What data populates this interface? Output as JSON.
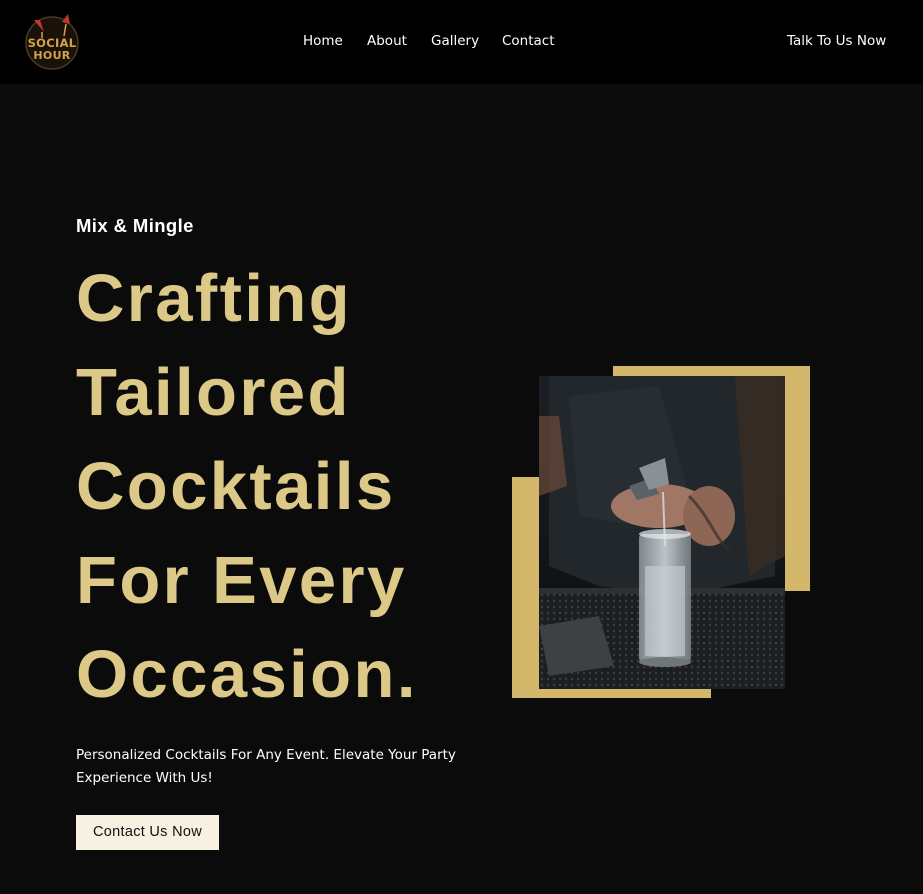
{
  "logo": {
    "line1": "SOCIAL",
    "line2": "HOUR"
  },
  "nav": {
    "home": "Home",
    "about": "About",
    "gallery": "Gallery",
    "contact": "Contact",
    "cta": "Talk To Us Now"
  },
  "hero": {
    "eyebrow": "Mix & Mingle",
    "headline": [
      "Crafting",
      "Tailored",
      "Cocktails",
      "For Every",
      "Occasion."
    ],
    "description": "Personalized Cocktails For Any Event. Elevate Your Party Experience With Us!",
    "button": "Contact Us Now"
  },
  "colors": {
    "accent_gold": "#dcc987",
    "frame_gold": "#d3b86b",
    "background": "#0b0b0b",
    "header": "#000000",
    "button_bg": "#f8f0e0"
  }
}
